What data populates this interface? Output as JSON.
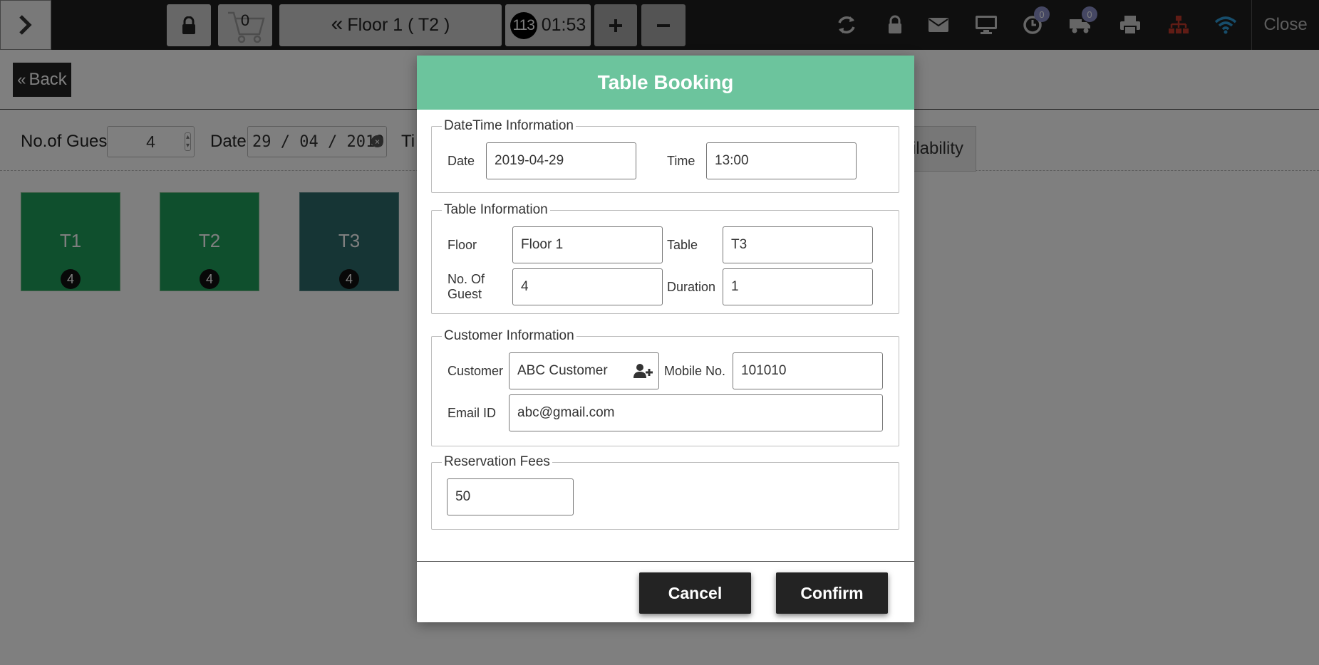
{
  "topbar": {
    "cart_count": "0",
    "floor_label": "Floor 1 ( T2 )",
    "timer_number": "113",
    "timer_clock": "01:53",
    "history_badge": "0",
    "delivery_badge": "0",
    "close_label": "Close"
  },
  "page": {
    "back_label": "Back",
    "guest_label": "No.of Guest",
    "guest_value": "4",
    "date_label": "Date",
    "date_value": "29 / 04 / 2019",
    "time_label_partial": "Ti",
    "availability_partial": "ilability",
    "tables": [
      {
        "name": "T1",
        "seats": "4"
      },
      {
        "name": "T2",
        "seats": "4"
      },
      {
        "name": "T3",
        "seats": "4"
      }
    ]
  },
  "colors": {
    "header_green": "#6cc49d",
    "table_available": "#1e9e5a",
    "table_selected": "#2d6b6b"
  },
  "modal": {
    "title": "Table Booking",
    "datetime": {
      "legend": "DateTime Information",
      "date_label": "Date",
      "date_value": "2019-04-29",
      "time_label": "Time",
      "time_value": "13:00"
    },
    "table": {
      "legend": "Table Information",
      "floor_label": "Floor",
      "floor_value": "Floor 1",
      "table_label": "Table",
      "table_value": "T3",
      "guest_label_1": "No. Of",
      "guest_label_2": "Guest",
      "guest_value": "4",
      "duration_label": "Duration",
      "duration_value": "1"
    },
    "customer": {
      "legend": "Customer Information",
      "customer_label": "Customer",
      "customer_value": "ABC Customer",
      "mobile_label": "Mobile No.",
      "mobile_value": "101010",
      "email_label": "Email ID",
      "email_value": "abc@gmail.com"
    },
    "fees": {
      "legend": "Reservation Fees",
      "value": "50"
    },
    "cancel_label": "Cancel",
    "confirm_label": "Confirm"
  }
}
